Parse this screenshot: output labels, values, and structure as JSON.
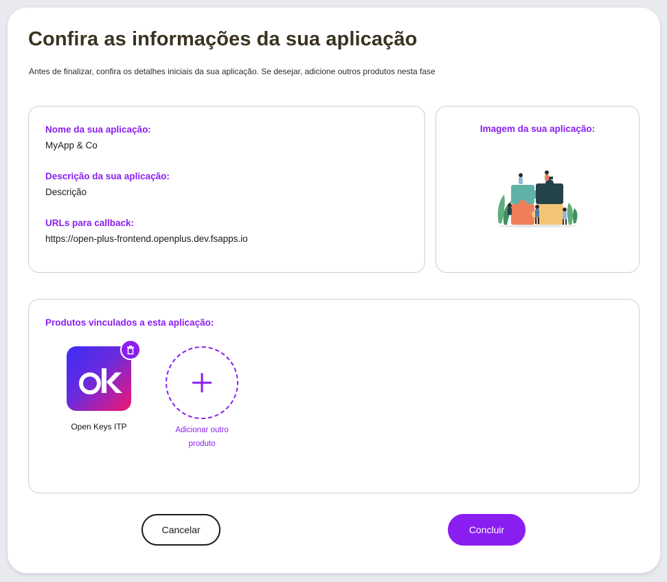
{
  "page": {
    "title": "Confira as informações da sua aplicação",
    "subtitle": "Antes de finalizar, confira os detalhes iniciais da sua aplicação. Se desejar, adicione outros produtos nesta fase"
  },
  "info": {
    "name_label": "Nome da sua aplicação:",
    "name_value": "MyApp & Co",
    "description_label": "Descrição da sua aplicação:",
    "description_value": "Descrição",
    "callback_label": "URLs para callback:",
    "callback_value": "https://open-plus-frontend.openplus.dev.fsapps.io"
  },
  "image_panel": {
    "label": "Imagem da sua aplicação:",
    "illustration": "puzzle-team-illustration"
  },
  "products": {
    "label": "Produtos vinculados a esta aplicação:",
    "items": [
      {
        "name": "Open Keys ITP",
        "logo_text": "ok",
        "icon": "trash-icon"
      }
    ],
    "add_label": "Adicionar outro produto",
    "add_icon": "plus-icon"
  },
  "actions": {
    "cancel_label": "Cancelar",
    "confirm_label": "Concluir"
  },
  "colors": {
    "accent": "#8a1ef0",
    "title": "#3a3322",
    "background": "#e9e9f0"
  }
}
